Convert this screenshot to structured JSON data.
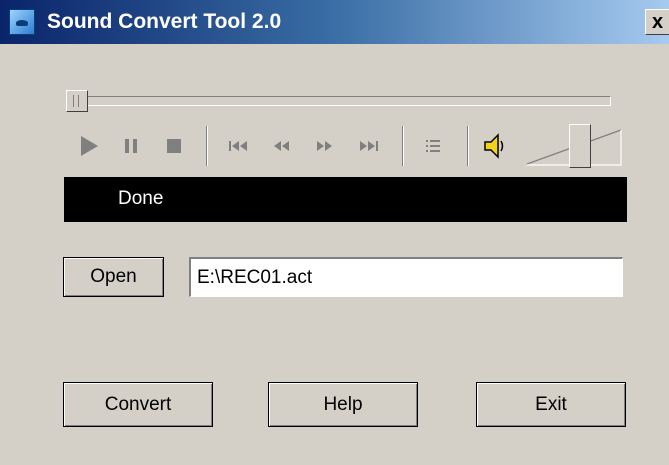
{
  "window": {
    "title": "Sound Convert Tool 2.0",
    "close_label": "x"
  },
  "player": {
    "seek_position": 0,
    "volume_level": 0.58,
    "status": "Done",
    "icons": [
      "play-icon",
      "pause-icon",
      "stop-icon",
      "skip-to-start-icon",
      "rewind-icon",
      "fast-forward-icon",
      "skip-to-end-icon",
      "playlist-icon",
      "speaker-icon"
    ]
  },
  "file": {
    "open_label": "Open",
    "path": "E:\\REC01.act"
  },
  "actions": {
    "convert_label": "Convert",
    "help_label": "Help",
    "exit_label": "Exit"
  },
  "colors": {
    "window_bg": "#d4d0c8",
    "title_start": "#0a246a",
    "title_end": "#a6caf0",
    "status_bg": "#000000",
    "status_text": "#ffffff",
    "disabled_icon": "#808080"
  }
}
